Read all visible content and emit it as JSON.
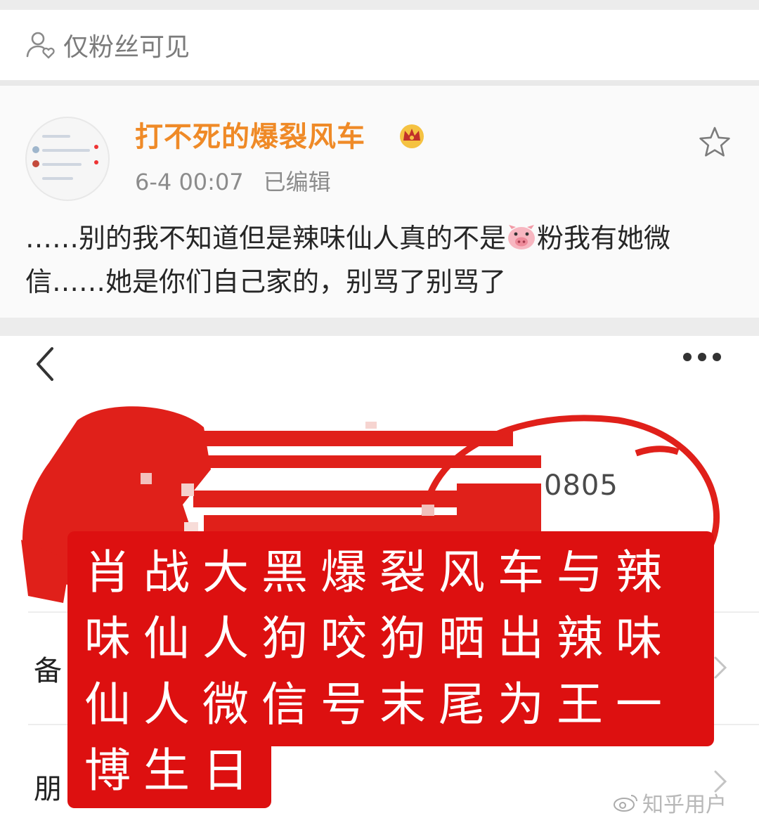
{
  "visibility": {
    "label": "仅粉丝可见",
    "icon": "fans-only-icon"
  },
  "post": {
    "username": "打不死的爆裂风车",
    "badge_icon": "crown-icon",
    "time": "6-4 00:07",
    "edited": "已编辑",
    "text_part1": "……别的我不知道但是辣味仙人真的不是",
    "emoji_icon": "pig-icon",
    "text_part2": "粉我有她微信……她是你们自己家的，别骂了别骂了"
  },
  "profile": {
    "back_icon": "back-chevron-icon",
    "more_icon": "more-dots-icon",
    "id_suffix": "0805",
    "row1_label": "备",
    "row2_label": "朋"
  },
  "caption": {
    "text": "肖战大黑爆裂风车与辣味仙人狗咬狗晒出辣味仙人微信号末尾为王一博生日"
  },
  "watermark": {
    "text": "知乎用户"
  },
  "colors": {
    "username": "#ef8a27",
    "caption_bg": "#dd1010",
    "redaction": "#e0201a"
  }
}
